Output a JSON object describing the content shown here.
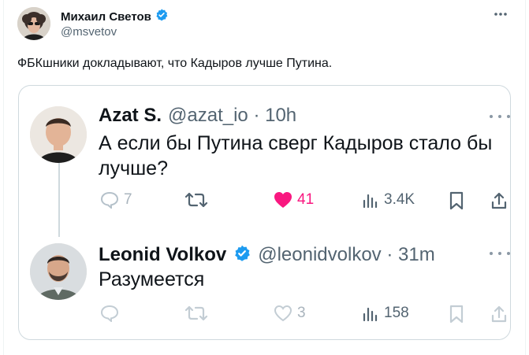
{
  "post": {
    "author_name": "Михаил Светов",
    "author_handle": "@msvetov",
    "text": "ФБКшники докладывают, что Кадыров лучше Путина."
  },
  "quote": {
    "first": {
      "name": "Azat S.",
      "meta": "@azat_io · 10h",
      "line1": "А если бы Путина сверг Кадыров стало бы",
      "line2": "лучше?",
      "replies": "7",
      "likes": "41",
      "views": "3.4K"
    },
    "second": {
      "name": "Leonid Volkov",
      "meta": "@leonidvolkov · 31m",
      "text": "Разумеется",
      "likes": "3",
      "views": "158"
    }
  },
  "colors": {
    "verified": "#1d9bf0",
    "like_active": "#f91880",
    "secondary_text": "#536471"
  },
  "icons": [
    "verified-icon",
    "more-icon",
    "reply-icon",
    "retweet-icon",
    "heart-icon",
    "views-icon",
    "bookmark-icon",
    "share-icon"
  ]
}
